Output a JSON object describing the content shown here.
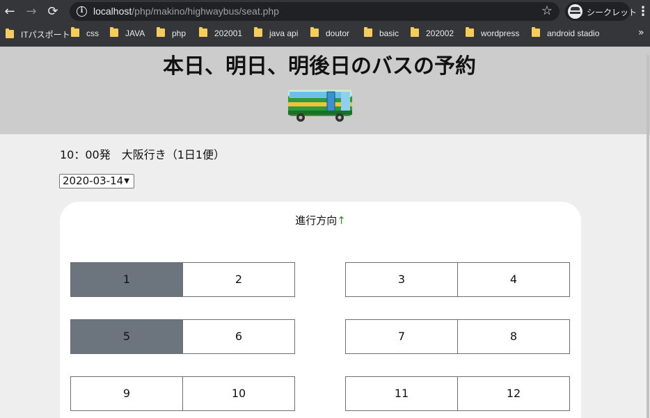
{
  "browser": {
    "url_host": "localhost",
    "url_path": "/php/makino/highwaybus/seat.php",
    "incognito_label": "シークレット",
    "bookmarks": [
      "ITパスポート",
      "css",
      "JAVA",
      "php",
      "202001",
      "java api",
      "doutor",
      "basic",
      "202002",
      "wordpress",
      "android stadio"
    ]
  },
  "page": {
    "title": "本日、明日、明後日のバスの予約",
    "departure": "10：00発　大阪行き（1日1便）",
    "date_selected": "2020-03-14",
    "direction_label": "進行方向",
    "direction_arrow": "↑"
  },
  "seats": [
    {
      "label": "1",
      "taken": true
    },
    {
      "label": "2",
      "taken": false
    },
    {
      "label": "3",
      "taken": false
    },
    {
      "label": "4",
      "taken": false
    },
    {
      "label": "5",
      "taken": true
    },
    {
      "label": "6",
      "taken": false
    },
    {
      "label": "7",
      "taken": false
    },
    {
      "label": "8",
      "taken": false
    },
    {
      "label": "9",
      "taken": false
    },
    {
      "label": "10",
      "taken": false
    },
    {
      "label": "11",
      "taken": false
    },
    {
      "label": "12",
      "taken": false
    }
  ],
  "colors": {
    "header_bg": "#cccccc",
    "page_bg": "#eeeeee",
    "seat_taken": "#6c757d",
    "seat_free": "#ffffff",
    "arrow": "#3a8a3a"
  }
}
